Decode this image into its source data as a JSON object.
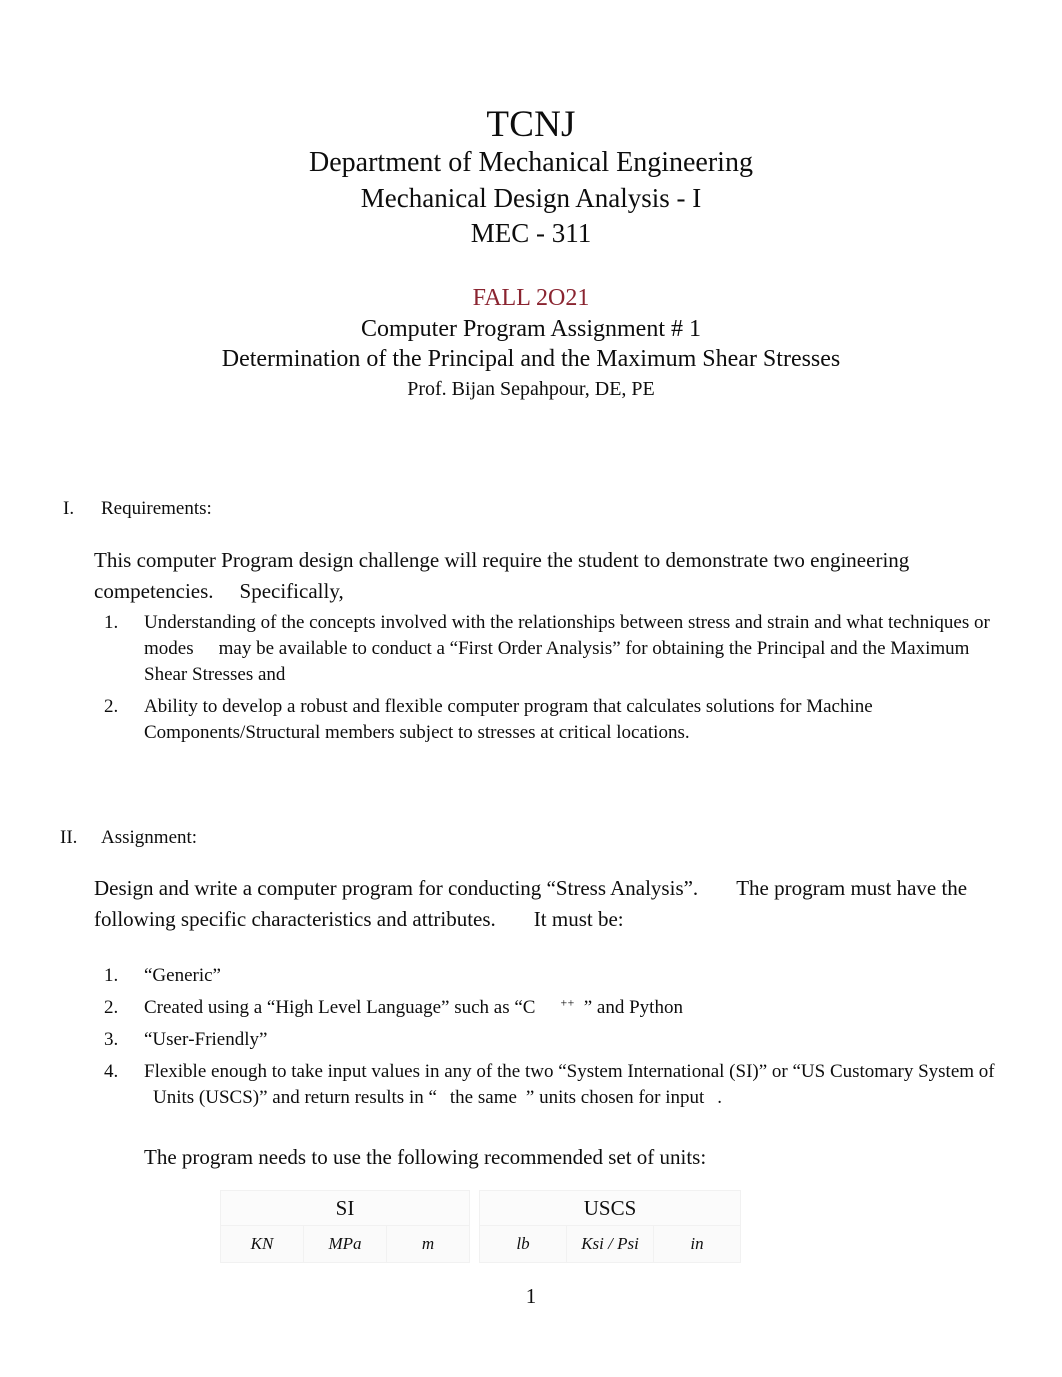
{
  "header": {
    "org": "TCNJ",
    "department": "Department of Mechanical Engineering",
    "course_name": "Mechanical Design Analysis - I",
    "course_code": "MEC - 311",
    "term": "FALL 2O21",
    "term_color": "#8a2430",
    "assignment_title": "Computer Program Assignment # 1",
    "assignment_subtitle": "Determination of the Principal and the Maximum Shear Stresses",
    "instructor": "Prof. Bijan Sepahpour, DE, PE"
  },
  "sections": [
    {
      "numeral": "I.",
      "heading": "Requirements:",
      "intro_part1": "This computer Program design challenge will require the student to demonstrate two engineering competencies.",
      "intro_part2": "Specifically,",
      "items": [
        {
          "marker": "1.",
          "text_a": "Understanding of the concepts involved with the relationships between stress and strain and what techniques or modes",
          "text_b": "may be available to conduct a “First Order Analysis” for obtaining the Principal and the Maximum Shear Stresses and"
        },
        {
          "marker": "2.",
          "text_a": "Ability to develop a robust and flexible computer program that calculates solutions for Machine Components/Structural members subject to stresses at critical locations.",
          "text_b": ""
        }
      ]
    },
    {
      "numeral": "II.",
      "heading": "Assignment:",
      "intro_part1": "Design and write a computer program for conducting “Stress Analysis”.",
      "intro_part2": "The program must have the following specific characteristics and attributes.",
      "intro_part3": "It must be:",
      "items": [
        {
          "marker": "1.",
          "text": "“Generic”"
        },
        {
          "marker": "2.",
          "text_pre": "Created using a “High Level Language” such as “C",
          "superscript": "++",
          "text_post": "” and Python"
        },
        {
          "marker": "3.",
          "text": "“User‐Friendly”"
        },
        {
          "marker": "4.",
          "text_a": "Flexible enough to take input values in any of the two “System International (SI)” or “US Customary System of",
          "text_b": "Units (USCS)” and return results in “",
          "text_c": "the same",
          "text_d": "” units chosen for input",
          "text_e": "."
        }
      ]
    }
  ],
  "units": {
    "lead_in": "The program needs to use the following recommended set of units:",
    "groups": [
      {
        "label": "SI",
        "cells": [
          "KN",
          "MPa",
          "m"
        ]
      },
      {
        "label": "USCS",
        "cells": [
          "lb",
          "Ksi / Psi",
          "in"
        ]
      }
    ]
  },
  "footer": {
    "page_number": "1"
  }
}
